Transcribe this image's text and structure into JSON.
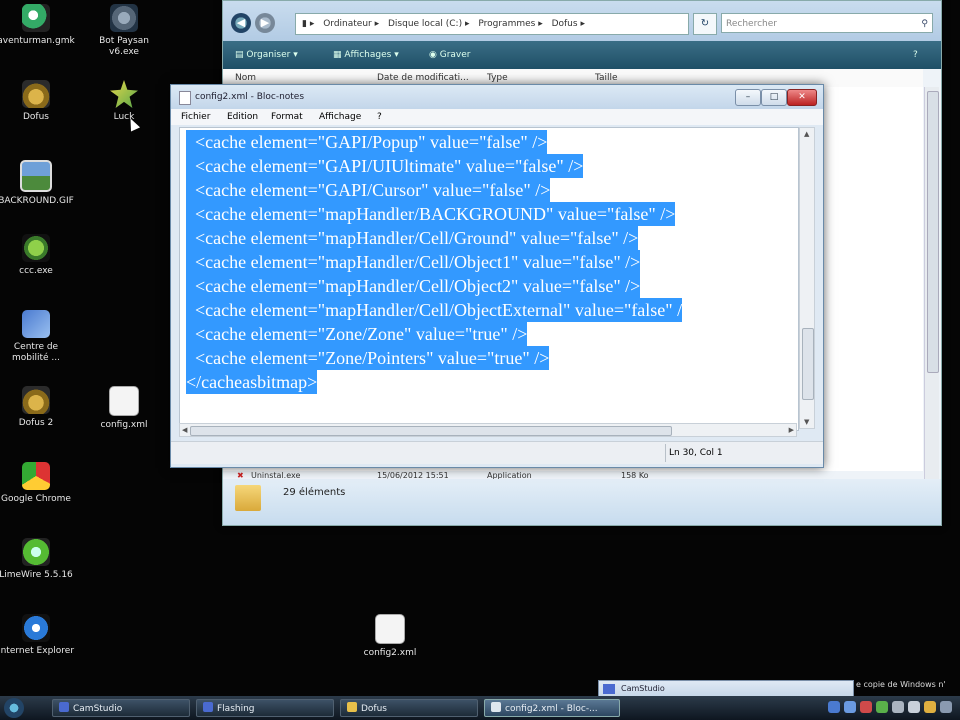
{
  "desktop": {
    "icons": [
      {
        "label": "aventurman.gmk"
      },
      {
        "label": "Bot Paysan v6.exe"
      },
      {
        "label": "Dofus"
      },
      {
        "label": "Luck"
      },
      {
        "label": "BACKROUND.GIF"
      },
      {
        "label": "ccc.exe"
      },
      {
        "label": "Centre de mobilité ..."
      },
      {
        "label": "Dofus 2"
      },
      {
        "label": "config.xml"
      },
      {
        "label": "Google Chrome"
      },
      {
        "label": "LimeWire 5.5.16"
      },
      {
        "label": "Internet Explorer"
      },
      {
        "label": "config2.xml"
      }
    ]
  },
  "explorer": {
    "breadcrumb": [
      "Ordinateur",
      "Disque local (C:)",
      "Programmes",
      "Dofus"
    ],
    "search_placeholder": "Rechercher",
    "toolbar": {
      "organize": "Organiser",
      "views": "Affichages",
      "burn": "Graver"
    },
    "columns": [
      "Nom",
      "Date de modificati...",
      "Type",
      "Taille"
    ],
    "partial_row": {
      "name": "Uninstal.exe",
      "date": "15/06/2012 15:51",
      "type": "Application",
      "size": "158 Ko"
    },
    "item_count": "29 éléments"
  },
  "notepad": {
    "title": "config2.xml - Bloc-notes",
    "menu": [
      "Fichier",
      "Edition",
      "Format",
      "Affichage",
      "?"
    ],
    "lines": [
      "  <cache element=\"GAPI/Popup\" value=\"false\" />",
      "  <cache element=\"GAPI/UIUltimate\" value=\"false\" />",
      "  <cache element=\"GAPI/Cursor\" value=\"false\" />",
      "  <cache element=\"mapHandler/BACKGROUND\" value=\"false\" />",
      "  <cache element=\"mapHandler/Cell/Ground\" value=\"false\" />",
      "  <cache element=\"mapHandler/Cell/Object1\" value=\"false\" />",
      "  <cache element=\"mapHandler/Cell/Object2\" value=\"false\" />",
      "  <cache element=\"mapHandler/Cell/ObjectExternal\" value=\"false\" /",
      "  <cache element=\"Zone/Zone\" value=\"true\" />",
      "  <cache element=\"Zone/Pointers\" value=\"true\" />",
      "</cacheasbitmap>"
    ],
    "status_position": "Ln 30, Col 1"
  },
  "popup": {
    "title": "CamStudio"
  },
  "watermark_text": "e copie de Windows n'",
  "taskbar": {
    "buttons": [
      {
        "label": "CamStudio"
      },
      {
        "label": "Flashing"
      },
      {
        "label": "Dofus"
      },
      {
        "label": "config2.xml - Bloc-..."
      }
    ]
  }
}
